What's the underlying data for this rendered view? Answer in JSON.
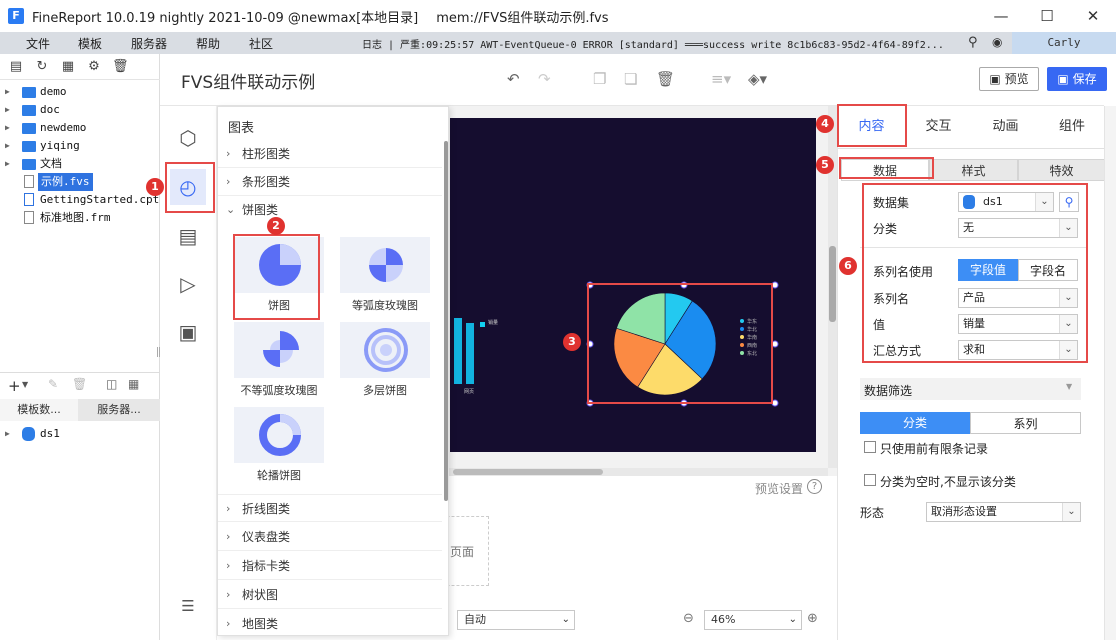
{
  "window": {
    "title": "FineReport 10.0.19 nightly 2021-10-09 @newmax[本地目录]",
    "doc_path": "mem://FVS组件联动示例.fvs",
    "minimize": "—",
    "maximize": "☐",
    "close": "✕"
  },
  "menubar": {
    "items": [
      "文件",
      "模板",
      "服务器",
      "帮助",
      "社区"
    ],
    "log": "日志 | 严重:09:25:57 AWT-EventQueue-0 ERROR [standard] ═══success write 8c1b6c83-95d2-4f64-89f2...",
    "user": "Carly"
  },
  "tree": {
    "items": [
      {
        "label": "demo",
        "type": "folder"
      },
      {
        "label": "doc",
        "type": "folder"
      },
      {
        "label": "newdemo",
        "type": "folder"
      },
      {
        "label": "yiqing",
        "type": "folder"
      },
      {
        "label": "文档",
        "type": "folder"
      },
      {
        "label": "示例.fvs",
        "type": "file"
      },
      {
        "label": "GettingStarted.cpt",
        "type": "file"
      },
      {
        "label": "标准地图.frm",
        "type": "file"
      }
    ],
    "lower_tabs": [
      "模板数...",
      "服务器..."
    ],
    "dataset": "ds1"
  },
  "header": {
    "title": "FVS组件联动示例",
    "preview": "预览",
    "save": "保存"
  },
  "chart_popup": {
    "title": "图表",
    "categories": [
      "柱形图类",
      "条形图类",
      "饼图类",
      "折线图类",
      "仪表盘类",
      "指标卡类",
      "树状图",
      "地图类"
    ],
    "thumbs": [
      "饼图",
      "等弧度玫瑰图",
      "不等弧度玫瑰图",
      "多层饼图",
      "轮播饼图"
    ]
  },
  "canvas": {
    "preview_settings": "预览设置",
    "page_label": "页面",
    "auto": "自动",
    "zoom": "46%",
    "chart_legend": [
      "华东",
      "华北",
      "华南",
      "西南",
      "东北"
    ],
    "bar_legend": "销量",
    "bar_axis": "网页"
  },
  "right_panel": {
    "tabs": [
      "内容",
      "交互",
      "动画",
      "组件"
    ],
    "subtabs": [
      "数据",
      "样式",
      "特效"
    ],
    "dataset_label": "数据集",
    "dataset_value": "ds1",
    "category_label": "分类",
    "category_value": "无",
    "series_name_use_label": "系列名使用",
    "series_name_use_options": [
      "字段值",
      "字段名"
    ],
    "series_name_label": "系列名",
    "series_name_value": "产品",
    "value_label": "值",
    "value_value": "销量",
    "summary_label": "汇总方式",
    "summary_value": "求和",
    "filter_label": "数据筛选",
    "filter_tabs": [
      "分类",
      "系列"
    ],
    "check_top": "只使用前有限条记录",
    "check_empty": "分类为空时,不显示该分类",
    "form_label": "形态",
    "form_value": "取消形态设置"
  },
  "markers": [
    "1",
    "2",
    "3",
    "4",
    "5",
    "6"
  ],
  "colors": {
    "accent": "#3768f3",
    "marker": "#e0322f",
    "canvas_bg": "#150d2f",
    "pie": [
      "#23c9f0",
      "#1a8cf0",
      "#fddb6a",
      "#fb8a43",
      "#8fe3a7"
    ]
  }
}
